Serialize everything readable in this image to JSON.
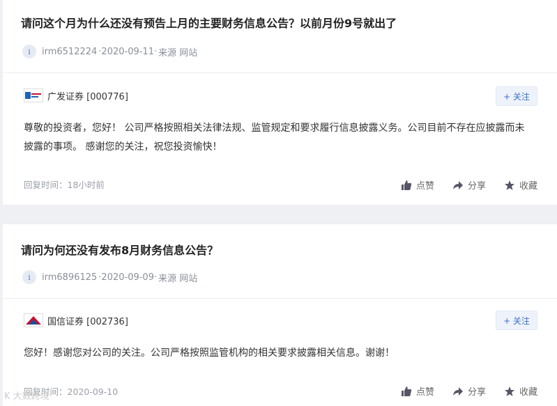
{
  "posts": [
    {
      "question": "请问这个月为什么还没有预告上月的主要财务信息公告？以前月份9号就出了",
      "user": "irm6512224",
      "date": "·2020-09-11·",
      "source": "来源 网站",
      "company": "广发证券 [000776]",
      "follow_label": "+ 关注",
      "answer": "尊敬的投资者，您好！ 公司严格按照相关法律法规、监管规定和要求履行信息披露义务。公司目前不存在应披露而未披露的事项。 感谢您的关注，祝您投资愉快！",
      "reply_time": "回复时间：18小时前",
      "like_label": "点赞",
      "share_label": "分享",
      "collect_label": "收藏"
    },
    {
      "question": "请问为何还没有发布8月财务信息公告？",
      "user": "irm6896125",
      "date": "·2020-09-09·",
      "source": "来源 网站",
      "company": "国信证券 [002736]",
      "follow_label": "+ 关注",
      "answer": "您好！感谢您对公司的关注。公司严格按照监管机构的相关要求披露相关信息。谢谢！",
      "reply_time": "回复时间：2020-09-10",
      "like_label": "点赞",
      "share_label": "分享",
      "collect_label": "收藏"
    }
  ],
  "watermark": "K 大数跨境",
  "colors": {
    "accent": "#3a6fc4",
    "meta": "#8a8f99",
    "bg": "#eef0f3"
  }
}
